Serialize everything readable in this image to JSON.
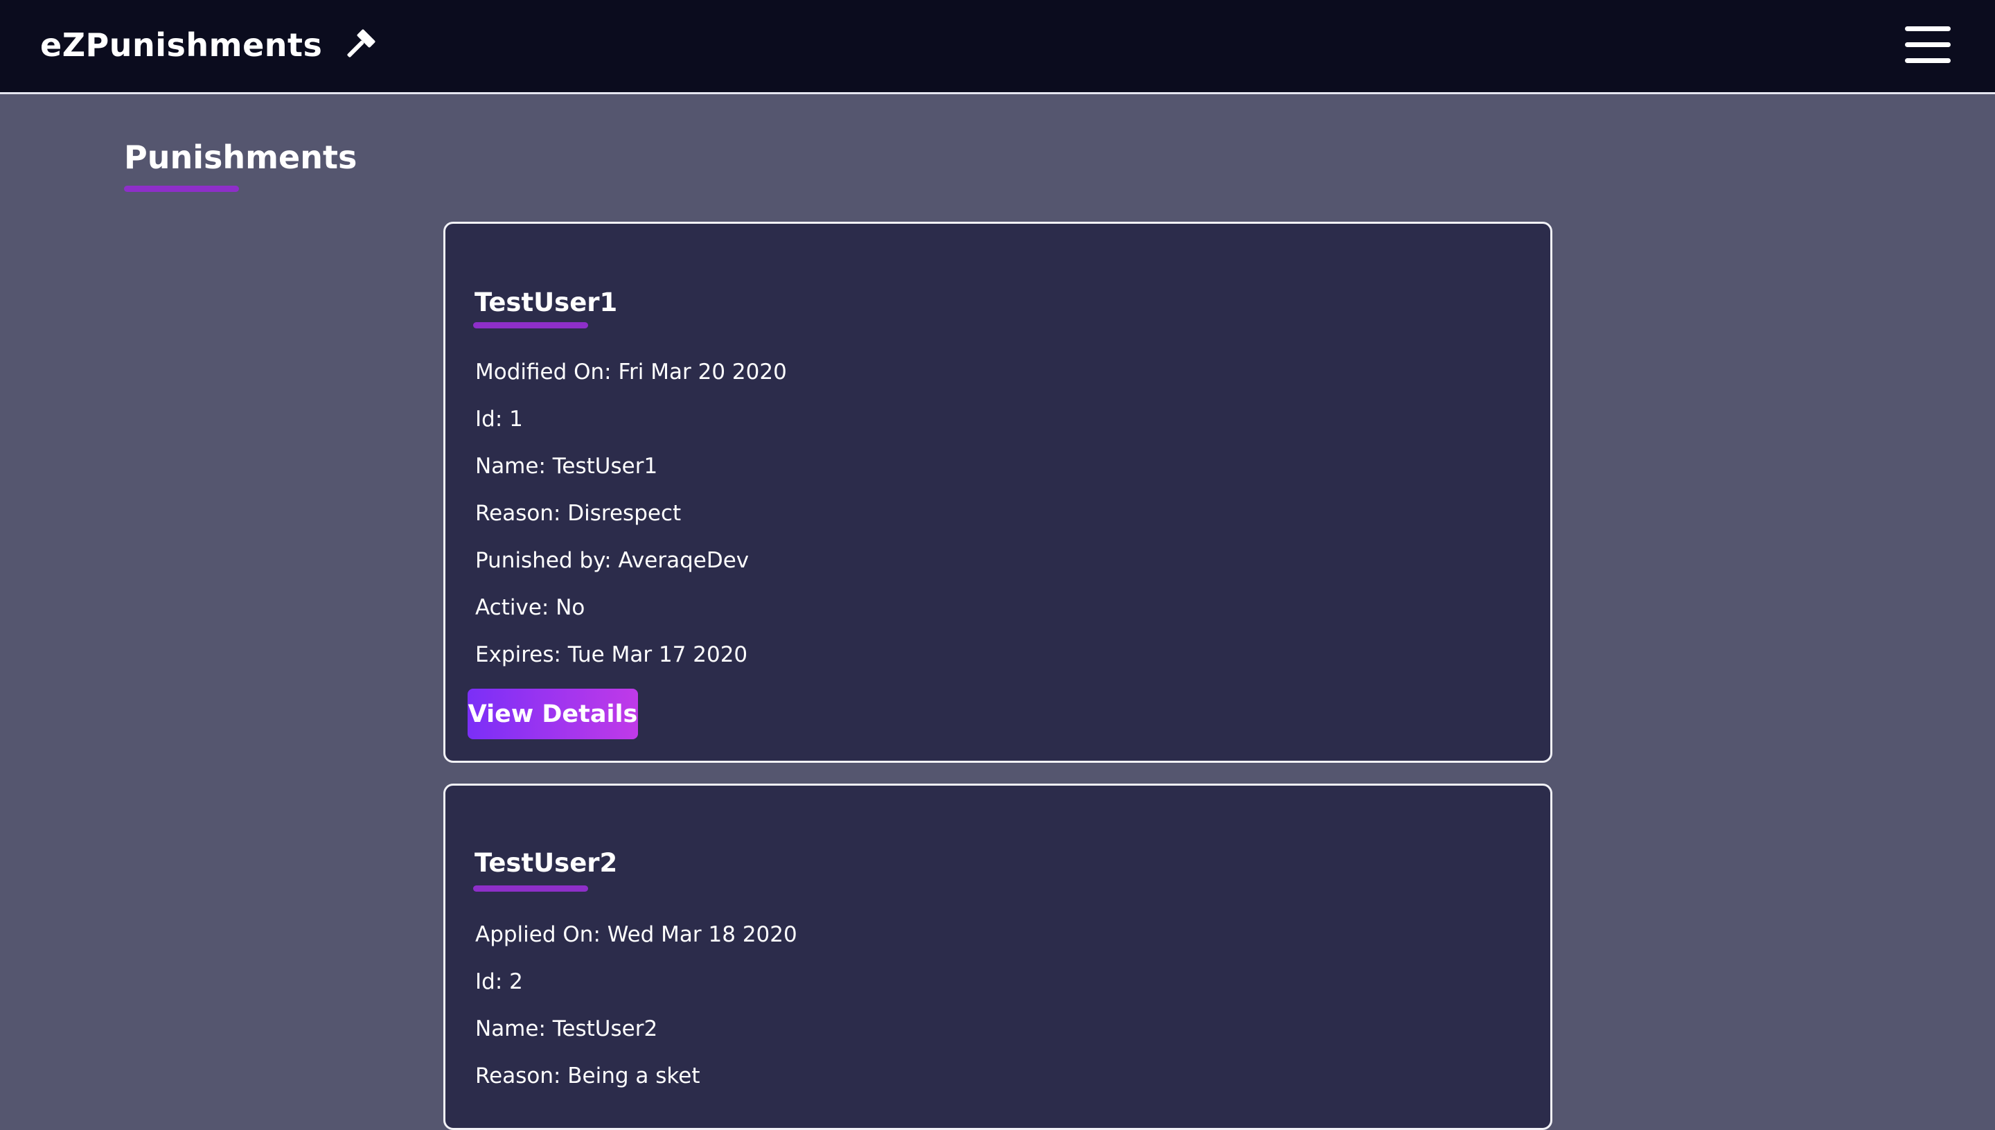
{
  "navbar": {
    "brand": "eZPunishments",
    "brand_icon": "gavel-icon",
    "menu_icon": "hamburger-menu-icon"
  },
  "page": {
    "title": "Punishments"
  },
  "punishments": [
    {
      "name": "TestUser1",
      "fields": [
        "Modified On: Fri Mar 20 2020",
        "Id: 1",
        "Name: TestUser1",
        "Reason: Disrespect",
        "Punished by: AveraqeDev",
        "Active: No",
        "Expires: Tue Mar 17 2020"
      ],
      "button_label": "View Details"
    },
    {
      "name": "TestUser2",
      "fields": [
        "Applied On: Wed Mar 18 2020",
        "Id: 2",
        "Name: TestUser2",
        "Reason: Being a sket"
      ]
    }
  ],
  "colors": {
    "page_bg": "#55566f",
    "navbar_bg": "#0b0c1e",
    "card_bg": "#2c2c4b",
    "accent_underline": "#8e2fc9",
    "button_gradient_start": "#7b2ff7",
    "button_gradient_end": "#c03ae8"
  }
}
